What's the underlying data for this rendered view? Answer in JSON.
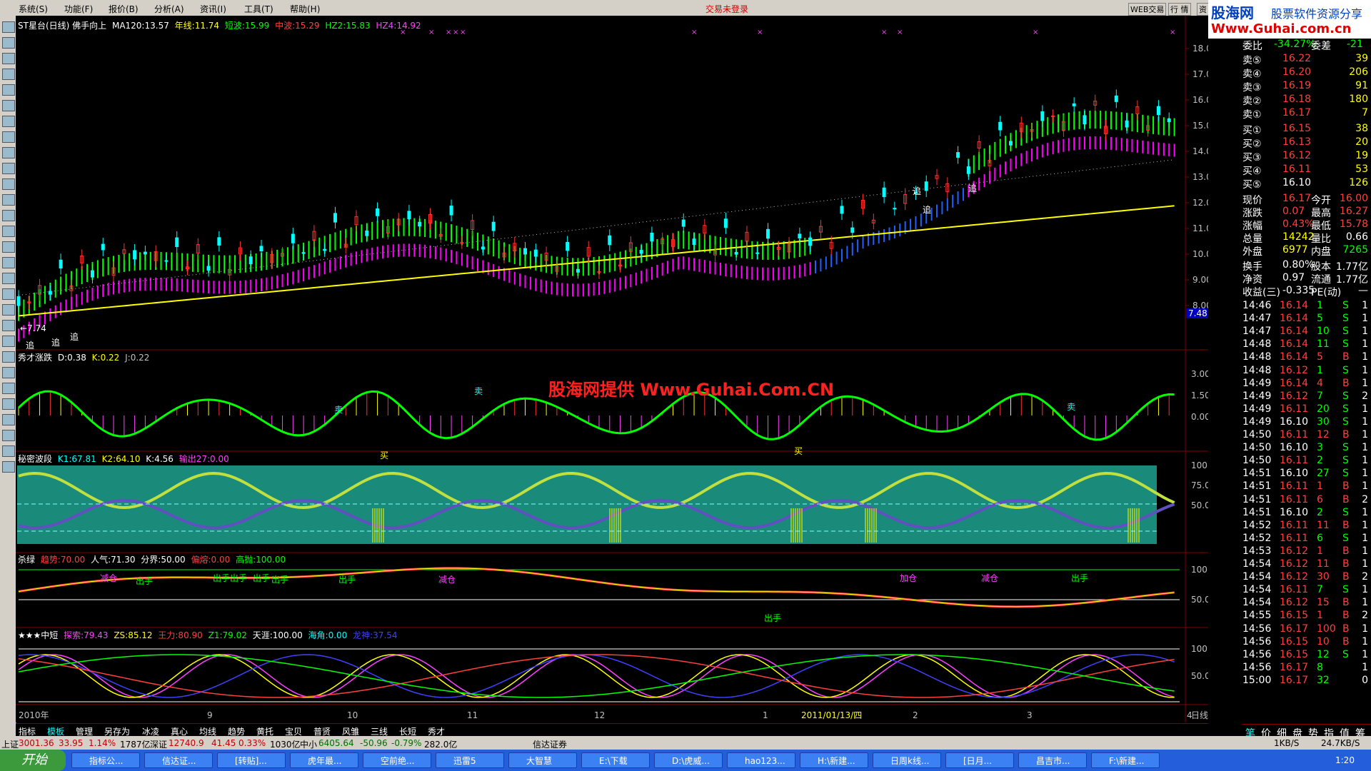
{
  "menu": {
    "items": [
      "系统(S)",
      "功能(F)",
      "报价(B)",
      "分析(A)",
      "资讯(I)",
      "工具(T)",
      "帮助(H)"
    ],
    "trade_status": "交易未登录",
    "right_buttons": [
      "WEB交易",
      "行 情",
      "资 讯"
    ]
  },
  "logo": {
    "brand": "股海网",
    "slogan": "股票软件资源分享",
    "url": "Www.Guhai.com.cn"
  },
  "main_pane": {
    "title": "ST星台(日线) 佛手向上",
    "indicators": [
      {
        "text": "MA120:13.57",
        "color": "#ffffff"
      },
      {
        "text": "年线:11.74",
        "color": "#ffff00"
      },
      {
        "text": "短波:15.99",
        "color": "#00ff00"
      },
      {
        "text": "中波:15.29",
        "color": "#ff4040"
      },
      {
        "text": "HZ2:15.83",
        "color": "#00ff00"
      },
      {
        "text": "HZ4:14.92",
        "color": "#ff40ff"
      }
    ],
    "price_axis": [
      "18.00",
      "17.00",
      "16.00",
      "15.00",
      "14.00",
      "13.00",
      "12.00",
      "11.00",
      "10.00",
      "9.00",
      "8.00"
    ],
    "price_box": "7.48",
    "low_label": "←7.74",
    "chase_labels": [
      "追",
      "追",
      "追",
      "追",
      "追",
      "追"
    ]
  },
  "pane2": {
    "title": "秀才涨跌",
    "values": [
      {
        "text": "D:0.38",
        "color": "#ffffff"
      },
      {
        "text": "K:0.22",
        "color": "#ffff00"
      },
      {
        "text": "J:0.22",
        "color": "#c0c0c0"
      }
    ],
    "axis": [
      "3.00",
      "1.50",
      "0.00"
    ],
    "watermark": "股海网提供 Www.Guhai.Com.CN",
    "buy_labels": [
      "买",
      "买"
    ],
    "sell_labels": [
      "卖",
      "卖",
      "卖"
    ]
  },
  "pane3": {
    "title": "秘密波段",
    "values": [
      {
        "text": "K1:67.81",
        "color": "#00ffff"
      },
      {
        "text": "K2:64.10",
        "color": "#ffff00"
      },
      {
        "text": "K:4.56",
        "color": "#ffffff"
      },
      {
        "text": "输出27:0.00",
        "color": "#ff40ff"
      }
    ],
    "axis": [
      "100.0",
      "75.00",
      "50.00"
    ]
  },
  "pane4": {
    "title": "杀绿",
    "values": [
      {
        "text": "趋势:70.00",
        "color": "#ff4040"
      },
      {
        "text": "人气:71.30",
        "color": "#ffffff"
      },
      {
        "text": "分界:50.00",
        "color": "#ffffff"
      },
      {
        "text": "偏熔:0.00",
        "color": "#ff4040"
      },
      {
        "text": "高抛:100.00",
        "color": "#00ff00"
      }
    ],
    "axis": [
      "100.0",
      "50.00"
    ],
    "labels": [
      "出手",
      "出手",
      "出手",
      "出手",
      "出手",
      "出手",
      "出手",
      "出手",
      "出手",
      "减仓",
      "减仓",
      "减仓",
      "加仓"
    ]
  },
  "pane5": {
    "title": "★★★中短",
    "values": [
      {
        "text": "探索:79.43",
        "color": "#ff40ff"
      },
      {
        "text": "ZS:85.12",
        "color": "#ffff00"
      },
      {
        "text": "王力:80.90",
        "color": "#ff4040"
      },
      {
        "text": "Z1:79.02",
        "color": "#00ff00"
      },
      {
        "text": "天涯:100.00",
        "color": "#ffffff"
      },
      {
        "text": "海角:0.00",
        "color": "#00ffff"
      },
      {
        "text": "龙神:37.54",
        "color": "#4040ff"
      }
    ],
    "axis": [
      "100.0",
      "50.00"
    ]
  },
  "date_axis": {
    "labels": [
      "2010年",
      "9",
      "10",
      "11",
      "12",
      "1",
      "2011/01/13/四",
      "2",
      "3",
      "4"
    ],
    "period": "日线"
  },
  "bottom_tabs": [
    "指标",
    "模板",
    "管理",
    "另存为",
    "冰凌",
    "真心",
    "均线",
    "趋势",
    "黄托",
    "宝贝",
    "普贤",
    "风雏",
    "三线",
    "长短",
    "秀才"
  ],
  "quote_panel": {
    "header": {
      "label": "委比",
      "value": "-34.27%",
      "label2": "委差",
      "value2": "-21"
    },
    "sell": [
      {
        "label": "卖⑤",
        "price": "16.22",
        "vol": "39"
      },
      {
        "label": "卖④",
        "price": "16.20",
        "vol": "206"
      },
      {
        "label": "卖③",
        "price": "16.19",
        "vol": "91"
      },
      {
        "label": "卖②",
        "price": "16.18",
        "vol": "180"
      },
      {
        "label": "卖①",
        "price": "16.17",
        "vol": "7"
      }
    ],
    "buy": [
      {
        "label": "买①",
        "price": "16.15",
        "vol": "38"
      },
      {
        "label": "买②",
        "price": "16.13",
        "vol": "20"
      },
      {
        "label": "买③",
        "price": "16.12",
        "vol": "19"
      },
      {
        "label": "买④",
        "price": "16.11",
        "vol": "53"
      },
      {
        "label": "买⑤",
        "price": "16.10",
        "vol": "126"
      }
    ],
    "stats": [
      {
        "l1": "现价",
        "v1": "16.17",
        "l2": "今开",
        "v2": "16.00"
      },
      {
        "l1": "涨跌",
        "v1": "0.07",
        "l2": "最高",
        "v2": "16.27"
      },
      {
        "l1": "涨幅",
        "v1": "0.43%",
        "l2": "最低",
        "v2": "15.78"
      },
      {
        "l1": "总量",
        "v1": "14242",
        "l2": "量比",
        "v2": "0.66"
      },
      {
        "l1": "外盘",
        "v1": "6977",
        "l2": "内盘",
        "v2": "7265"
      }
    ],
    "stats2": [
      {
        "l1": "换手",
        "v1": "0.80%",
        "l2": "股本",
        "v2": "1.77亿"
      },
      {
        "l1": "净资",
        "v1": "0.97",
        "l2": "流通",
        "v2": "1.77亿"
      },
      {
        "l1": "收益(三)",
        "v1": "-0.335",
        "l2": "PE(动)",
        "v2": "—"
      }
    ],
    "ticks": [
      {
        "t": "14:46",
        "p": "16.14",
        "v": "1",
        "s": "S",
        "n": "1"
      },
      {
        "t": "14:47",
        "p": "16.14",
        "v": "5",
        "s": "S",
        "n": "1"
      },
      {
        "t": "14:47",
        "p": "16.14",
        "v": "10",
        "s": "S",
        "n": "1"
      },
      {
        "t": "14:48",
        "p": "16.14",
        "v": "11",
        "s": "S",
        "n": "1"
      },
      {
        "t": "14:48",
        "p": "16.14",
        "v": "5",
        "s": "B",
        "n": "1"
      },
      {
        "t": "14:48",
        "p": "16.12",
        "v": "1",
        "s": "S",
        "n": "1"
      },
      {
        "t": "14:49",
        "p": "16.14",
        "v": "4",
        "s": "B",
        "n": "1"
      },
      {
        "t": "14:49",
        "p": "16.12",
        "v": "7",
        "s": "S",
        "n": "2"
      },
      {
        "t": "14:49",
        "p": "16.11",
        "v": "20",
        "s": "S",
        "n": "1"
      },
      {
        "t": "14:49",
        "p": "16.10",
        "v": "30",
        "s": "S",
        "n": "1"
      },
      {
        "t": "14:50",
        "p": "16.11",
        "v": "12",
        "s": "B",
        "n": "1"
      },
      {
        "t": "14:50",
        "p": "16.10",
        "v": "3",
        "s": "S",
        "n": "1"
      },
      {
        "t": "14:50",
        "p": "16.11",
        "v": "2",
        "s": "S",
        "n": "1"
      },
      {
        "t": "14:51",
        "p": "16.10",
        "v": "27",
        "s": "S",
        "n": "1"
      },
      {
        "t": "14:51",
        "p": "16.11",
        "v": "1",
        "s": "B",
        "n": "1"
      },
      {
        "t": "14:51",
        "p": "16.11",
        "v": "6",
        "s": "B",
        "n": "2"
      },
      {
        "t": "14:51",
        "p": "16.10",
        "v": "2",
        "s": "S",
        "n": "1"
      },
      {
        "t": "14:52",
        "p": "16.11",
        "v": "11",
        "s": "B",
        "n": "1"
      },
      {
        "t": "14:52",
        "p": "16.11",
        "v": "6",
        "s": "S",
        "n": "1"
      },
      {
        "t": "14:53",
        "p": "16.12",
        "v": "1",
        "s": "B",
        "n": "1"
      },
      {
        "t": "14:54",
        "p": "16.12",
        "v": "11",
        "s": "B",
        "n": "1"
      },
      {
        "t": "14:54",
        "p": "16.12",
        "v": "30",
        "s": "B",
        "n": "2"
      },
      {
        "t": "14:54",
        "p": "16.11",
        "v": "7",
        "s": "S",
        "n": "1"
      },
      {
        "t": "14:54",
        "p": "16.12",
        "v": "15",
        "s": "B",
        "n": "1"
      },
      {
        "t": "14:55",
        "p": "16.15",
        "v": "1",
        "s": "B",
        "n": "2"
      },
      {
        "t": "14:56",
        "p": "16.17",
        "v": "100",
        "s": "B",
        "n": "1"
      },
      {
        "t": "14:56",
        "p": "16.15",
        "v": "10",
        "s": "B",
        "n": "1"
      },
      {
        "t": "14:56",
        "p": "16.15",
        "v": "12",
        "s": "S",
        "n": "1"
      },
      {
        "t": "14:56",
        "p": "16.17",
        "v": "8",
        "s": "",
        "n": "1"
      },
      {
        "t": "15:00",
        "p": "16.17",
        "v": "32",
        "s": "",
        "n": "0"
      }
    ],
    "tabs": [
      "笔",
      "价",
      "细",
      "盘",
      "势",
      "指",
      "值",
      "筹"
    ]
  },
  "status_bar": {
    "sh_label": "上证",
    "sh": "3001.36",
    "sh_chg": "33.95",
    "sh_pct": "1.14%",
    "sh_amt": "1787亿",
    "sz_label": "深证",
    "sz": "12740.9",
    "sz_chg": "41.45",
    "sz_pct": "0.33%",
    "sz_amt": "1030亿",
    "zx_label": "中小",
    "zx": "6405.64",
    "zx_chg": "-50.96",
    "zx_pct": "-0.79%",
    "zx_amt": "282.0亿",
    "broker": "信达证券",
    "speed": "1KB/S",
    "speed2": "24.7KB/S"
  },
  "taskbar": {
    "start": "开始",
    "tasks": [
      "指标公...",
      "信达证...",
      "[转贴]...",
      "虎年最...",
      "空前绝...",
      "迅雷5",
      "大智慧",
      "E:\\下载",
      "D:\\虎威...",
      "hao123...",
      "H:\\新建...",
      "日周k线...",
      "[日月...",
      "昌吉市...",
      "F:\\新建..."
    ],
    "clock": "1:20"
  }
}
